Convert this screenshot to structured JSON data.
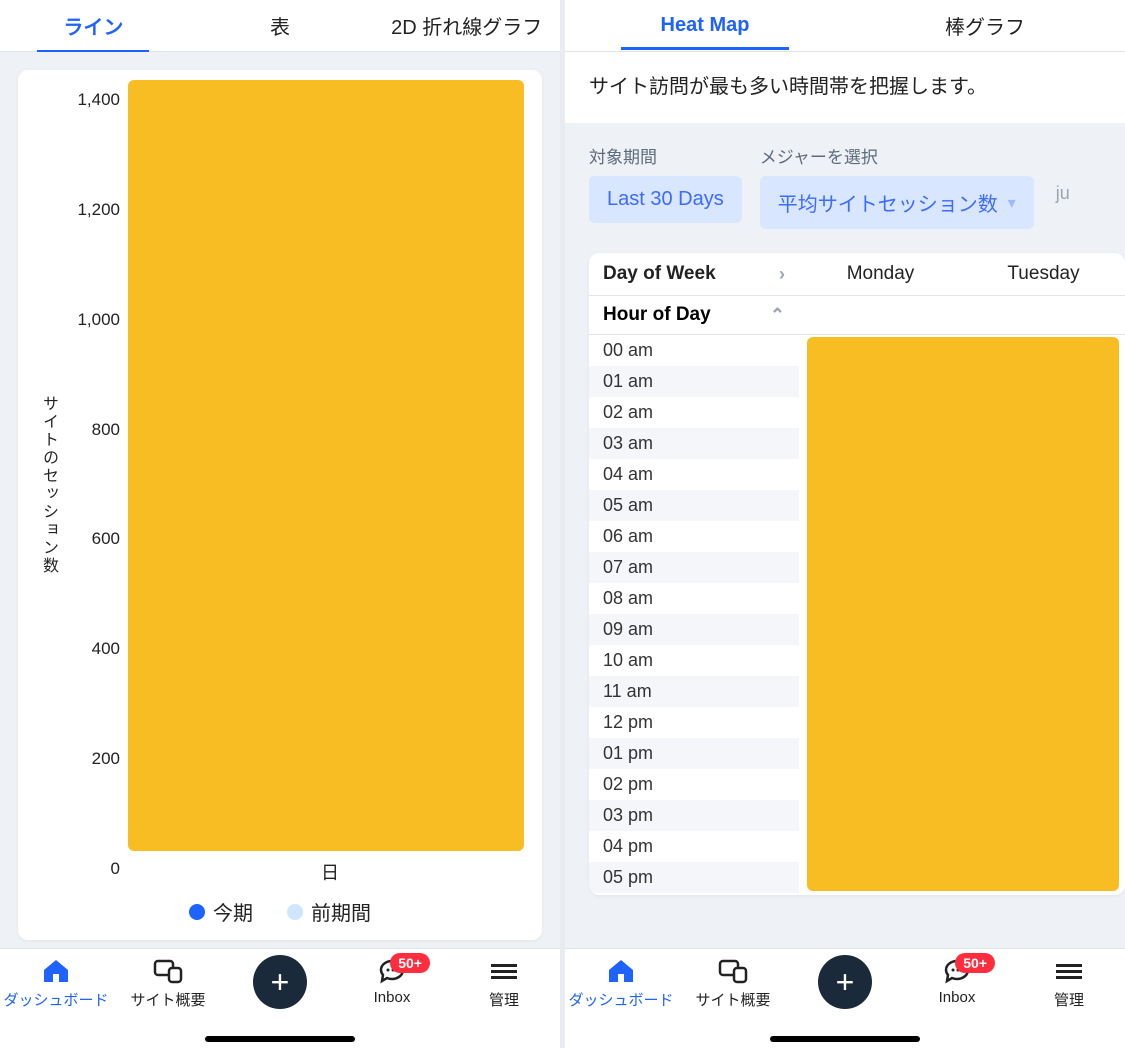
{
  "left": {
    "tabs": [
      "ライン",
      "表",
      "2D 折れ線グラフ"
    ],
    "active_tab": 0,
    "ylabel": "サイトのセッション数",
    "xlabel": "日",
    "yticks": [
      "1,400",
      "1,200",
      "1,000",
      "800",
      "600",
      "400",
      "200",
      "0"
    ],
    "legend": [
      {
        "label": "今期",
        "color": "#1e62ff"
      },
      {
        "label": "前期間",
        "color": "#cfe6ff"
      }
    ]
  },
  "right": {
    "tabs": [
      "Heat Map",
      "棒グラフ"
    ],
    "active_tab": 0,
    "subtitle": "サイト訪問が最も多い時間帯を把握します。",
    "controls": {
      "period_label": "対象期間",
      "period_value": "Last 30 Days",
      "measure_label": "メジャーを選択",
      "measure_value": "平均サイトセッション数"
    },
    "heat": {
      "col_header": "Day of Week",
      "row_header": "Hour of Day",
      "days": [
        "Monday",
        "Tuesday"
      ],
      "hours": [
        "00 am",
        "01 am",
        "02 am",
        "03 am",
        "04 am",
        "05 am",
        "06 am",
        "07 am",
        "08 am",
        "09 am",
        "10 am",
        "11 am",
        "12 pm",
        "01 pm",
        "02 pm",
        "03 pm",
        "04 pm",
        "05 pm"
      ]
    },
    "trimmed": "ju"
  },
  "nav": {
    "items": [
      {
        "label": "ダッシュボード"
      },
      {
        "label": "サイト概要"
      },
      {
        "label": ""
      },
      {
        "label": "Inbox",
        "badge": "50+"
      },
      {
        "label": "管理"
      }
    ]
  },
  "chart_data": [
    {
      "type": "line",
      "title": "",
      "xlabel": "日",
      "ylabel": "サイトのセッション数",
      "ylim": [
        0,
        1400
      ],
      "yticks": [
        0,
        200,
        400,
        600,
        800,
        1000,
        1200,
        1400
      ],
      "series": [
        {
          "name": "今期",
          "values": null
        },
        {
          "name": "前期間",
          "values": null
        }
      ],
      "note": "Plot region obscured by yellow overlay; data points not visible."
    },
    {
      "type": "heatmap",
      "title": "Heat Map",
      "x": [
        "Monday",
        "Tuesday"
      ],
      "y": [
        "00 am",
        "01 am",
        "02 am",
        "03 am",
        "04 am",
        "05 am",
        "06 am",
        "07 am",
        "08 am",
        "09 am",
        "10 am",
        "11 am",
        "12 pm",
        "01 pm",
        "02 pm",
        "03 pm",
        "04 pm",
        "05 pm"
      ],
      "values": null,
      "note": "Cell values obscured by yellow overlay."
    }
  ]
}
